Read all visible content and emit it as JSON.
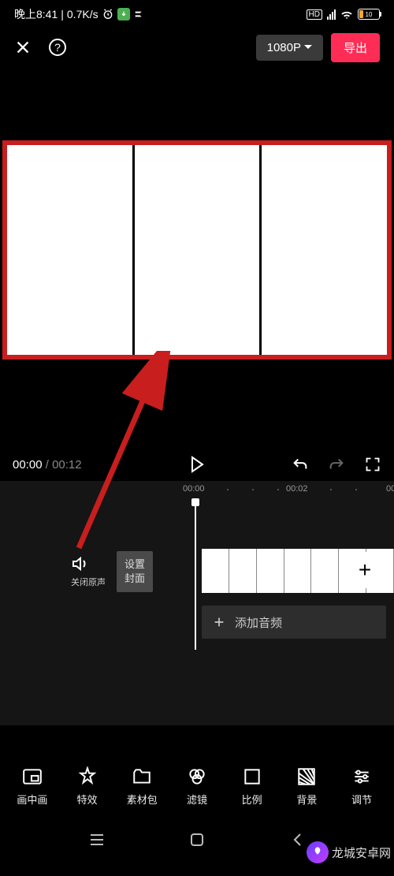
{
  "status": {
    "time": "晚上8:41",
    "speed": "0.7K/s",
    "battery": "10",
    "hd": "HD"
  },
  "header": {
    "resolution": "1080P",
    "export": "导出"
  },
  "controls": {
    "current": "00:00",
    "total": "00:12"
  },
  "timeline": {
    "t0": "00:00",
    "t1": "00:02",
    "t2": "00",
    "mute_label": "关闭原声",
    "cover_l1": "设置",
    "cover_l2": "封面",
    "add_audio": "添加音频",
    "plus": "+"
  },
  "tools": {
    "pip": "画中画",
    "fx": "特效",
    "pack": "素材包",
    "filter": "滤镜",
    "ratio": "比例",
    "bg": "背景",
    "adjust": "调节"
  },
  "watermark": "龙城安卓网"
}
